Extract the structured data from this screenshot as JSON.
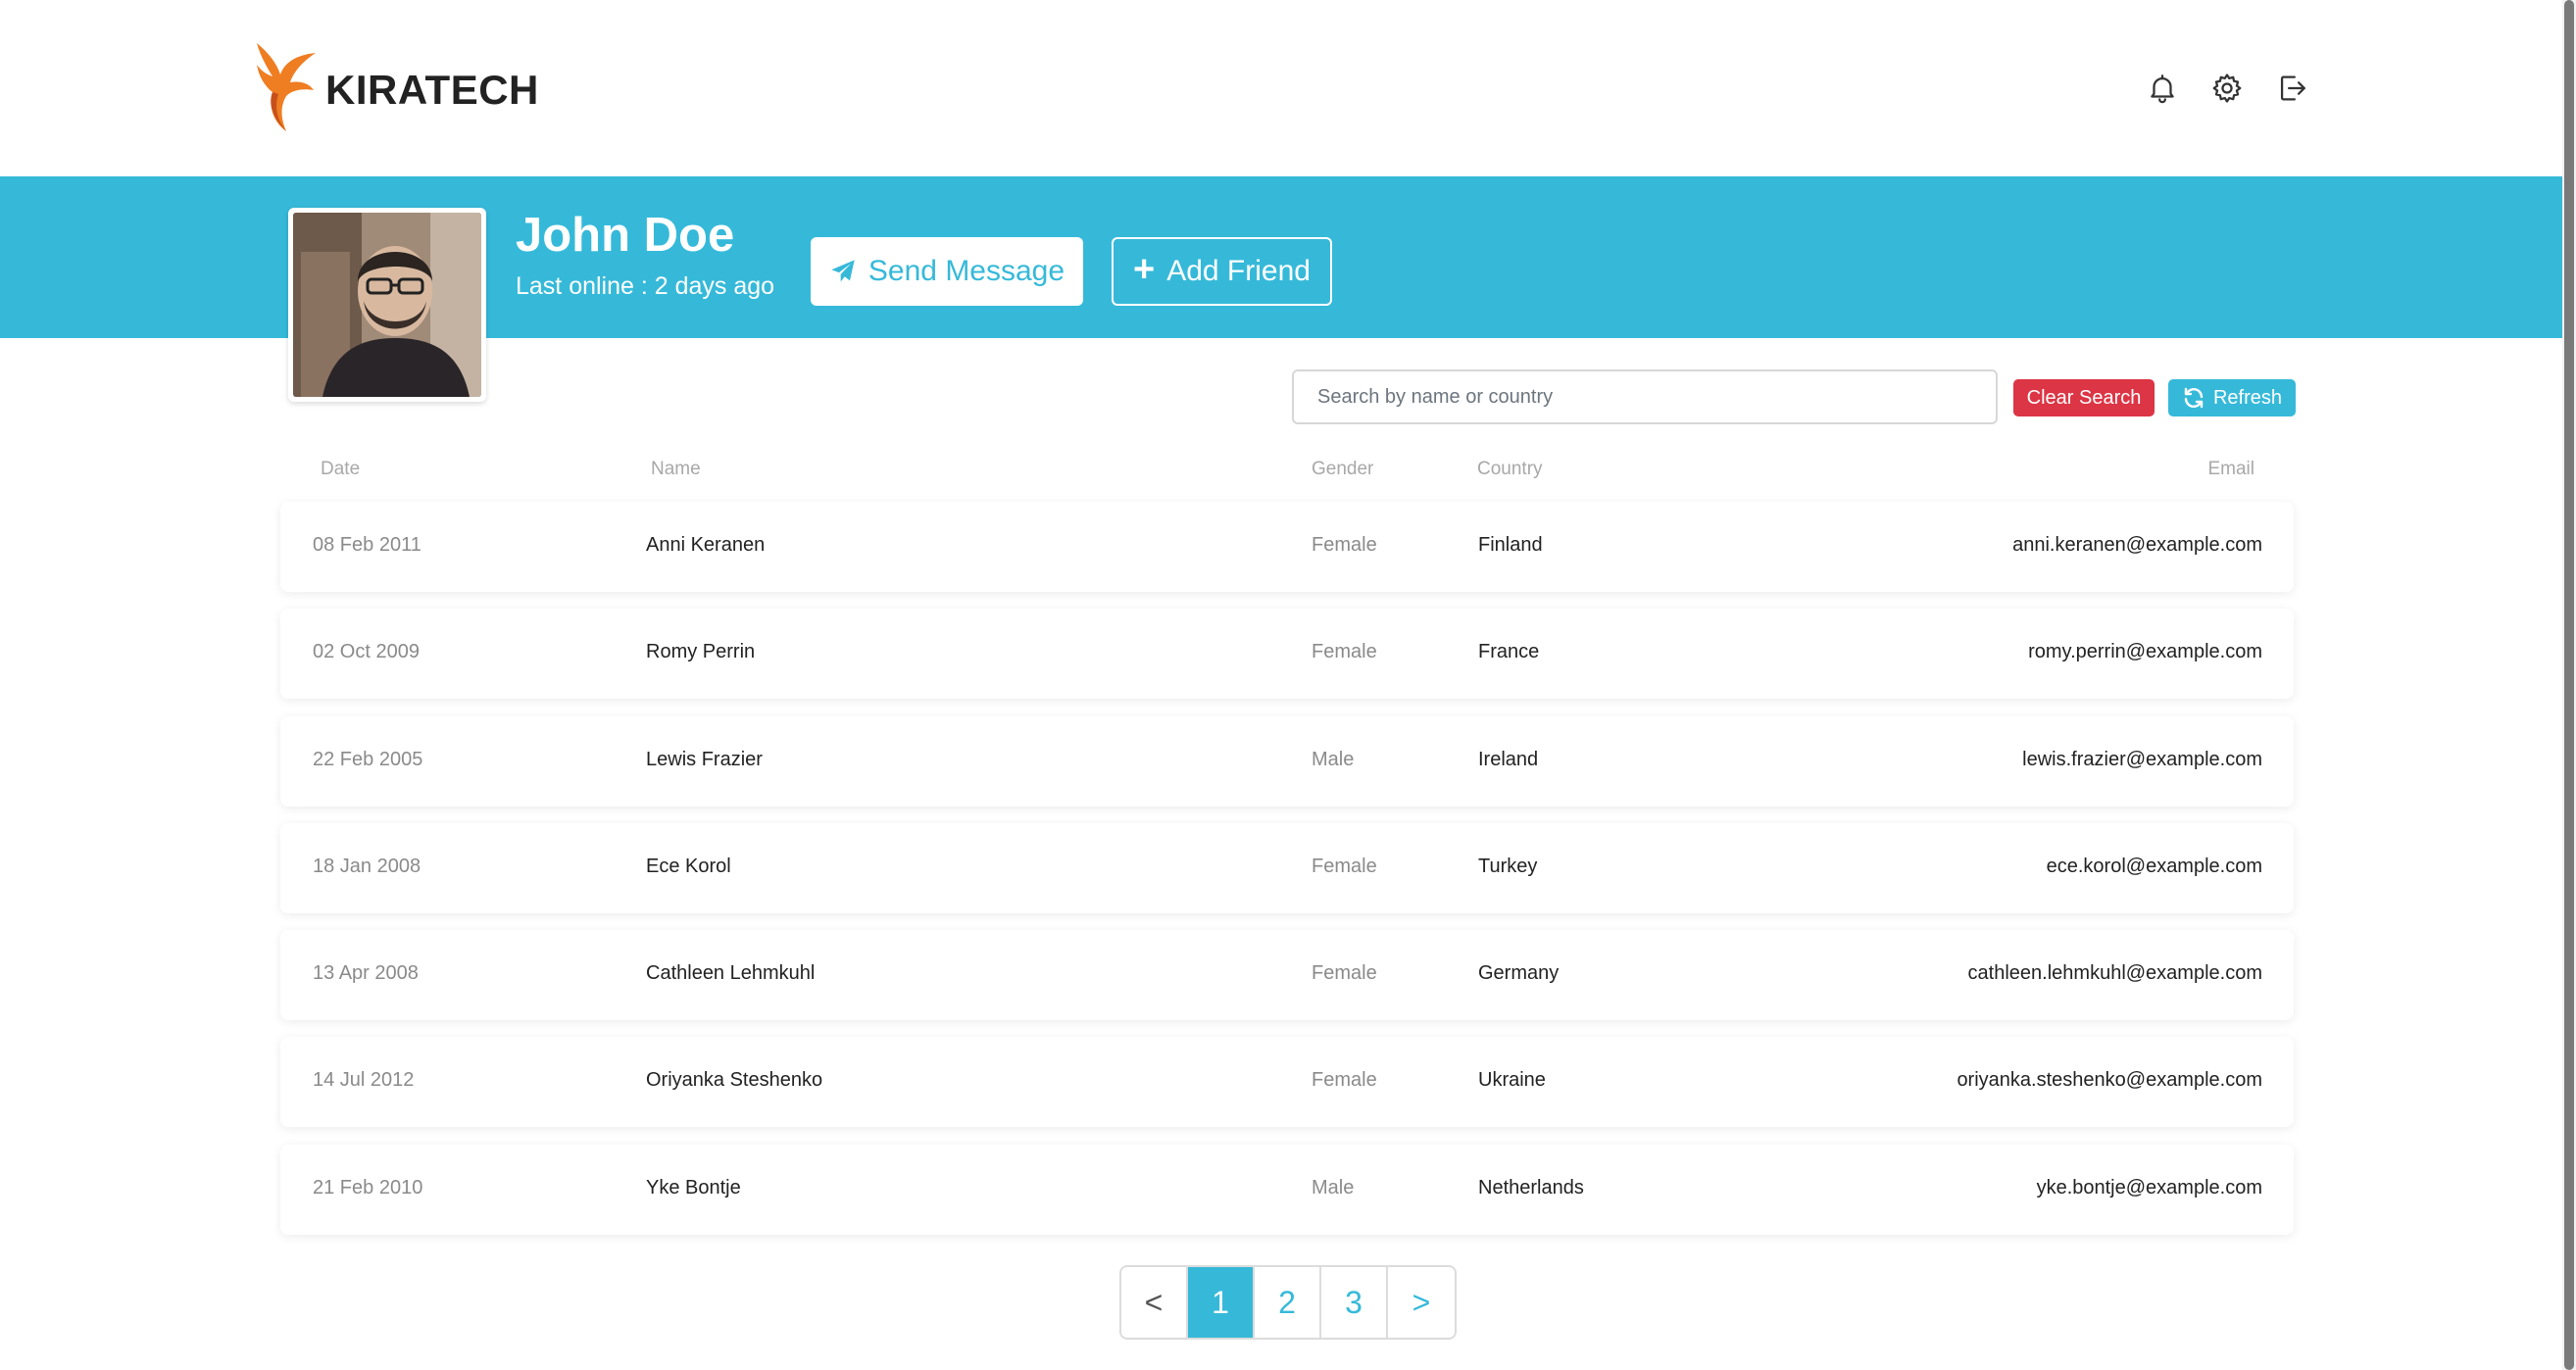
{
  "brand": {
    "name": "KIRATECH",
    "logo_icon": "bird-logo",
    "colors": {
      "primary": "#36b9d9",
      "danger": "#dc3545",
      "logo_orange": "#ef7d22"
    }
  },
  "header": {
    "icons": [
      "bell-icon",
      "gear-icon",
      "logout-icon"
    ]
  },
  "profile": {
    "name": "John Doe",
    "last_online": "Last online : 2 days ago",
    "send_message_label": "Send Message",
    "add_friend_label": "Add Friend"
  },
  "search": {
    "placeholder": "Search by name or country",
    "value": "",
    "clear_label": "Clear Search",
    "refresh_label": "Refresh"
  },
  "table": {
    "columns": [
      "Date",
      "Name",
      "Gender",
      "Country",
      "Email"
    ],
    "rows": [
      {
        "date": "08 Feb 2011",
        "name": "Anni Keranen",
        "gender": "Female",
        "country": "Finland",
        "email": "anni.keranen@example.com"
      },
      {
        "date": "02 Oct 2009",
        "name": "Romy Perrin",
        "gender": "Female",
        "country": "France",
        "email": "romy.perrin@example.com"
      },
      {
        "date": "22 Feb 2005",
        "name": "Lewis Frazier",
        "gender": "Male",
        "country": "Ireland",
        "email": "lewis.frazier@example.com"
      },
      {
        "date": "18 Jan 2008",
        "name": "Ece Korol",
        "gender": "Female",
        "country": "Turkey",
        "email": "ece.korol@example.com"
      },
      {
        "date": "13 Apr 2008",
        "name": "Cathleen Lehmkuhl",
        "gender": "Female",
        "country": "Germany",
        "email": "cathleen.lehmkuhl@example.com"
      },
      {
        "date": "14 Jul 2012",
        "name": "Oriyanka Steshenko",
        "gender": "Female",
        "country": "Ukraine",
        "email": "oriyanka.steshenko@example.com"
      },
      {
        "date": "21 Feb 2010",
        "name": "Yke Bontje",
        "gender": "Male",
        "country": "Netherlands",
        "email": "yke.bontje@example.com"
      }
    ]
  },
  "pagination": {
    "prev": "<",
    "next": ">",
    "pages": [
      "1",
      "2",
      "3"
    ],
    "current": "1"
  }
}
